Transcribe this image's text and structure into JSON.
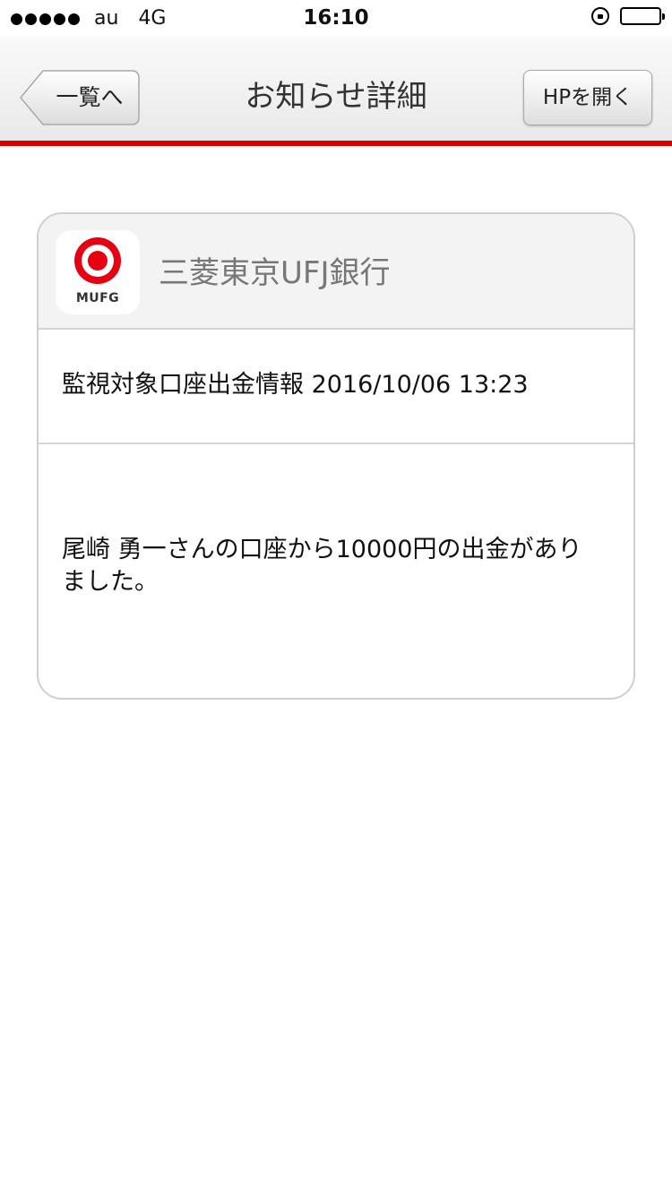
{
  "status_bar": {
    "carrier": "au",
    "network": "4G",
    "time": "16:10",
    "signal_bars": 5,
    "battery_level": 1.0,
    "icons": [
      "signal-dots-icon",
      "orientation-lock-icon",
      "battery-icon"
    ]
  },
  "nav": {
    "title": "お知らせ詳細",
    "back_label": "一覧へ",
    "hp_label": "HPを開く",
    "accent_color": "#d90000"
  },
  "notice": {
    "logo": {
      "text": "MUFG",
      "icon": "mufg-logo-icon",
      "color": "#e60012"
    },
    "bank_name": "三菱東京UFJ銀行",
    "subject": "監視対象口座出金情報 2016/10/06 13:23",
    "body": "尾崎 勇一さんの口座から10000円の出金がありました。"
  }
}
